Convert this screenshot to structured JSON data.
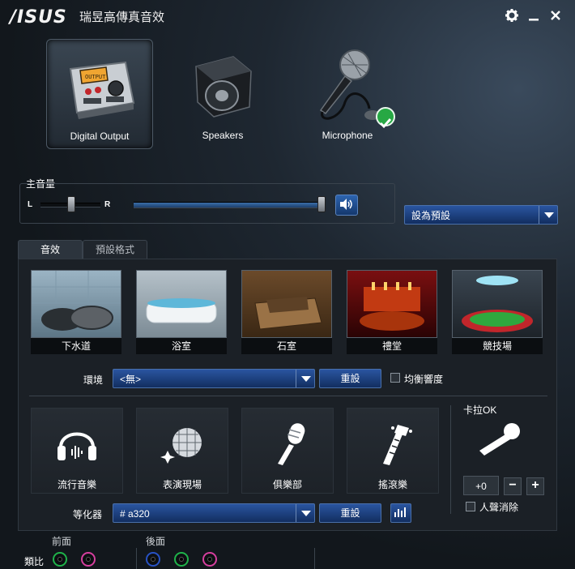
{
  "app": {
    "logo": "/ISUS",
    "title": "瑞昱高傳真音效"
  },
  "window": {
    "settings_icon": "gear-icon",
    "minimize_icon": "minimize-icon",
    "close_icon": "close-icon"
  },
  "devices": [
    {
      "label": "Digital Output",
      "icon": "digital-output-icon",
      "active": true
    },
    {
      "label": "Speakers",
      "icon": "speaker-icon",
      "active": false
    },
    {
      "label": "Microphone",
      "icon": "microphone-icon",
      "active": false,
      "status": "default-check"
    }
  ],
  "volume": {
    "label": "主音量",
    "left": "L",
    "right": "R",
    "balance": 0.5,
    "level": 0.98
  },
  "default_device": {
    "label": "設為預設"
  },
  "tabs": [
    {
      "label": "音效"
    },
    {
      "label": "預設格式"
    }
  ],
  "environments": [
    {
      "label": "下水道"
    },
    {
      "label": "浴室"
    },
    {
      "label": "石室"
    },
    {
      "label": "禮堂"
    },
    {
      "label": "競技場"
    }
  ],
  "environment_select": {
    "label": "環境",
    "value": "<無>",
    "reset": "重設",
    "loudness_label": "均衡響度",
    "loudness_checked": false
  },
  "genres": [
    {
      "label": "流行音樂"
    },
    {
      "label": "表演現場"
    },
    {
      "label": "俱樂部"
    },
    {
      "label": "搖滾樂"
    }
  ],
  "karaoke": {
    "title": "卡拉OK",
    "value": "+0",
    "minus": "−",
    "plus": "+",
    "vocal_cancel_label": "人聲消除",
    "vocal_cancel_checked": false
  },
  "equalizer": {
    "label": "等化器",
    "value": "# a320",
    "reset": "重設"
  },
  "jacks": {
    "front_label": "前面",
    "back_label": "後面",
    "analog_label": "類比"
  },
  "colors": {
    "accent": "#2a55a0",
    "background": "#12171c",
    "check": "#27a844",
    "jack_green": "#1fb34a",
    "jack_pink": "#d63f9e",
    "jack_blue": "#2852c4"
  }
}
